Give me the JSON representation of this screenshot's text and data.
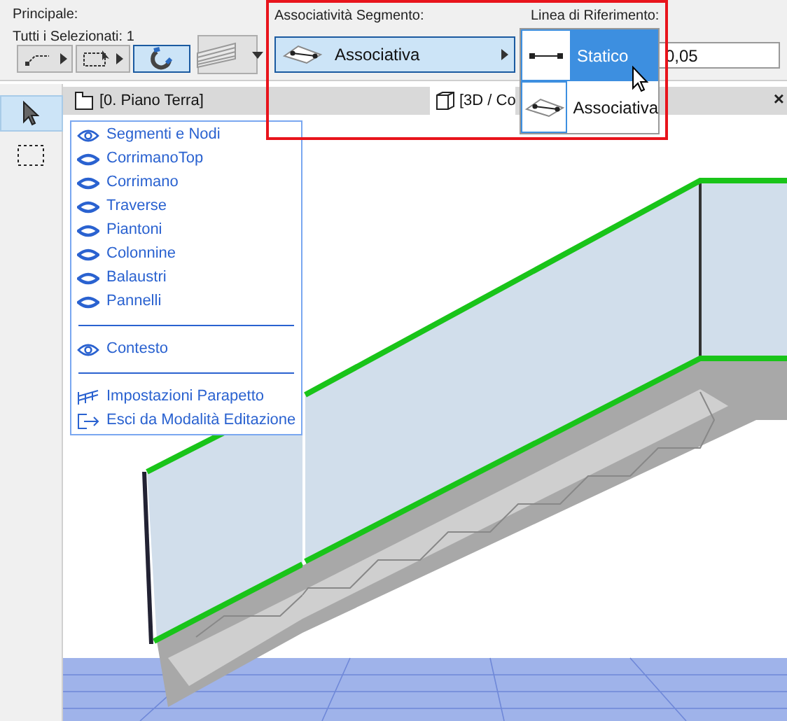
{
  "toolbar": {
    "principal": {
      "label": "Principale:",
      "selection": "Tutti i Selezionati: 1",
      "buttons": [
        {
          "kind": "segment",
          "selected": false
        },
        {
          "kind": "marquee",
          "selected": false
        },
        {
          "kind": "magnet",
          "selected": true
        },
        {
          "kind": "railing",
          "selected": false
        }
      ]
    },
    "segment_associativity": {
      "label": "Associatività Segmento:",
      "value": "Associativa"
    },
    "reference_line": {
      "label": "Linea di Riferimento:",
      "value": "0,05",
      "options": [
        {
          "label": "Statico",
          "kind": "static",
          "selected": true
        },
        {
          "label": "Associativa",
          "kind": "associative",
          "selected": false
        }
      ]
    }
  },
  "toolbox": [
    {
      "kind": "arrow",
      "selected": true
    },
    {
      "kind": "marquee",
      "selected": false
    }
  ],
  "tabs": [
    {
      "label": "[0. Piano Terra]",
      "kind": "plan"
    },
    {
      "label": "[3D / Co",
      "kind": "perspective"
    }
  ],
  "close": "×",
  "menu": {
    "groups": [
      [
        {
          "label": "Segmenti e Nodi",
          "kind": "eye-open"
        },
        {
          "label": "CorrimanoTop",
          "kind": "eye-closed"
        },
        {
          "label": "Corrimano",
          "kind": "eye-closed"
        },
        {
          "label": "Traverse",
          "kind": "eye-closed"
        },
        {
          "label": "Piantoni",
          "kind": "eye-closed"
        },
        {
          "label": "Colonnine",
          "kind": "eye-closed"
        },
        {
          "label": "Balaustri",
          "kind": "eye-closed"
        },
        {
          "label": "Pannelli",
          "kind": "eye-closed"
        }
      ],
      [
        {
          "label": "Contesto",
          "kind": "eye-open"
        }
      ],
      [
        {
          "label": "Impostazioni Parapetto",
          "kind": "railing"
        },
        {
          "label": "Esci da Modalità Editazione",
          "kind": "exit"
        }
      ]
    ]
  }
}
